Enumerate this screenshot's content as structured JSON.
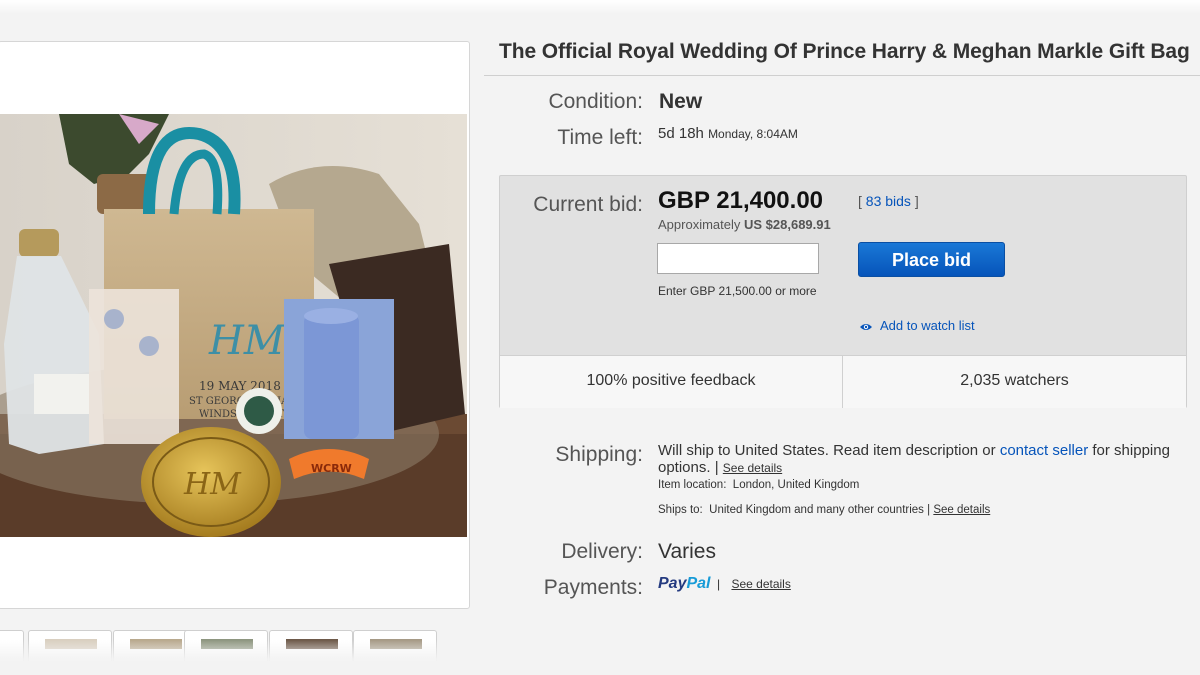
{
  "listing": {
    "title": "The Official Royal Wedding Of Prince Harry & Meghan Markle Gift Bag"
  },
  "condition": {
    "label": "Condition:",
    "value": "New"
  },
  "time_left": {
    "label": "Time left:",
    "value": "5d 18h",
    "detail": "Monday, 8:04AM"
  },
  "bid": {
    "label": "Current bid:",
    "price": "GBP 21,400.00",
    "approx_prefix": "Approximately",
    "approx_value": "US $28,689.91",
    "bids_open": "[",
    "bids_link": "83 bids",
    "bids_close": "]",
    "input_value": "",
    "hint": "Enter GBP 21,500.00 or more",
    "place_bid_label": "Place bid",
    "watch_label": "Add to watch list",
    "feedback": "100% positive feedback",
    "watchers": "2,035 watchers"
  },
  "shipping": {
    "label": "Shipping:",
    "text_before": "Will ship to United States. Read item description or",
    "contact_link": "contact seller",
    "text_after": "for shipping options.",
    "sep": "|",
    "see_details": "See details",
    "location_label": "Item location:",
    "location_value": "London, United Kingdom",
    "ships_to_label": "Ships to:",
    "ships_to_value": "United Kingdom and many other countries",
    "ships_sep": "|",
    "ships_see_details": "See details"
  },
  "delivery": {
    "label": "Delivery:",
    "value": "Varies"
  },
  "payments": {
    "label": "Payments:",
    "paypal_pay": "Pay",
    "paypal_pal": "Pal",
    "sep": "|",
    "see_details": "See details"
  },
  "colors": {
    "link": "#0654ba",
    "button": "#0654ba",
    "bid_box": "#e1e1e1",
    "paypal_dark": "#253b80",
    "paypal_light": "#179bd7"
  },
  "photo_text": {
    "monogram": "HM",
    "bag_line1": "19 MAY 2018",
    "bag_line2": "ST GEORGE'S CHAPEL",
    "bag_line3": "WINDSOR CASTLE",
    "wristband": "WCRW"
  }
}
